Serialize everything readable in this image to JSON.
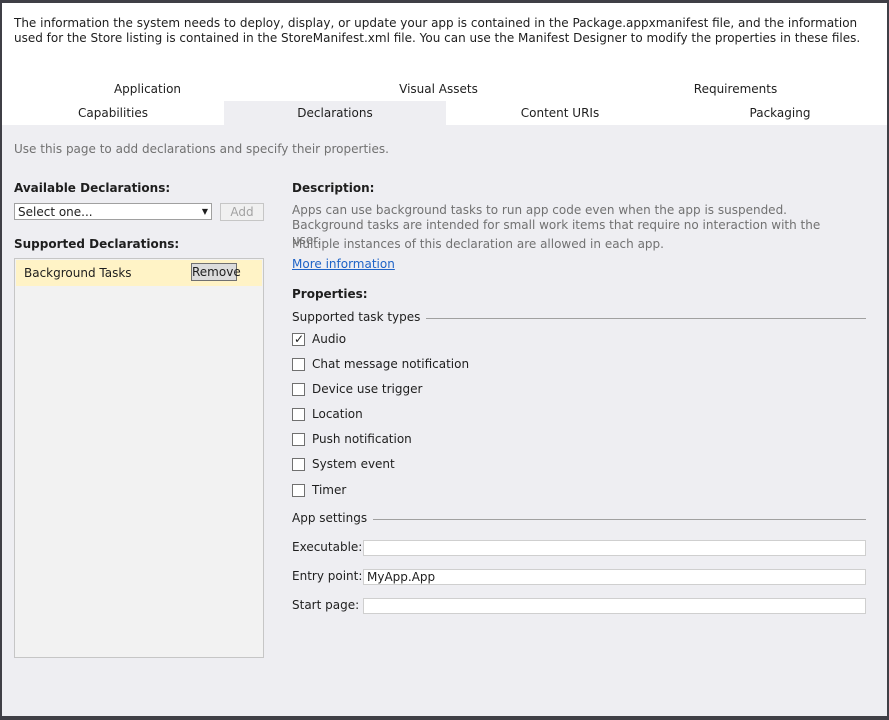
{
  "intro": {
    "text": "The information the system needs to deploy, display, or update your app is contained in the Package.appxmanifest file, and the information used for the Store listing is contained in the StoreManifest.xml file. You can use the Manifest Designer to modify the properties in these files."
  },
  "tabs": {
    "row1": [
      "Application",
      "Visual Assets",
      "Requirements"
    ],
    "row2": [
      "Capabilities",
      "Declarations",
      "Content URIs",
      "Packaging"
    ],
    "selected": "Declarations"
  },
  "page_hint": "Use this page to add declarations and specify their properties.",
  "available": {
    "label": "Available Declarations:",
    "select_value": "Select one...",
    "add_label": "Add"
  },
  "supported": {
    "label": "Supported Declarations:",
    "items": [
      {
        "label": "Background Tasks",
        "remove_label": "Remove"
      }
    ]
  },
  "description": {
    "label": "Description:",
    "text": "Apps can use background tasks to run app code even when the app is suspended. Background tasks are intended for small work items that require no interaction with the user.",
    "multi": "Multiple instances of this declaration are allowed in each app.",
    "link": "More information"
  },
  "properties": {
    "label": "Properties:",
    "task_types_label": "Supported task types",
    "task_types": [
      {
        "label": "Audio",
        "checked": true
      },
      {
        "label": "Chat message notification",
        "checked": false
      },
      {
        "label": "Device use trigger",
        "checked": false
      },
      {
        "label": "Location",
        "checked": false
      },
      {
        "label": "Push notification",
        "checked": false
      },
      {
        "label": "System event",
        "checked": false
      },
      {
        "label": "Timer",
        "checked": false
      }
    ],
    "app_settings_label": "App settings",
    "fields": [
      {
        "label": "Executable:",
        "value": ""
      },
      {
        "label": "Entry point:",
        "value": "MyApp.App"
      },
      {
        "label": "Start page:",
        "value": ""
      }
    ]
  }
}
